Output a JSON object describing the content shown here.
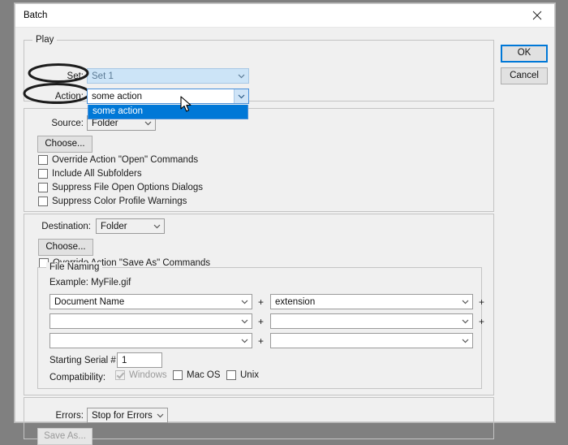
{
  "window": {
    "title": "Batch",
    "close_icon": "close-icon"
  },
  "buttons": {
    "ok": "OK",
    "cancel": "Cancel"
  },
  "play": {
    "legend": "Play",
    "set_label": "Set:",
    "set_value": "Set 1",
    "action_label": "Action:",
    "action_value": "some action",
    "action_options": [
      "some action"
    ]
  },
  "source": {
    "legend": "Source:",
    "label": "Source:",
    "value": "Folder",
    "choose_button": "Choose...",
    "checkboxes": [
      {
        "label": "Override Action \"Open\" Commands",
        "checked": false
      },
      {
        "label": "Include All Subfolders",
        "checked": false
      },
      {
        "label": "Suppress File Open Options Dialogs",
        "checked": false
      },
      {
        "label": "Suppress Color Profile Warnings",
        "checked": false
      }
    ]
  },
  "destination": {
    "label": "Destination:",
    "value": "Folder",
    "choose_button": "Choose...",
    "override_checkbox": {
      "label": "Override Action \"Save As\" Commands",
      "checked": false
    },
    "file_naming": {
      "legend": "File Naming",
      "example_label": "Example: MyFile.gif",
      "rows": [
        {
          "left": "Document Name",
          "right": "extension",
          "plus_left": "+",
          "plus_right": "+"
        },
        {
          "left": "",
          "right": "",
          "plus_left": "+",
          "plus_right": "+"
        },
        {
          "left": "",
          "right": "",
          "plus_left": "+",
          "plus_right": ""
        }
      ],
      "serial_label": "Starting Serial #:",
      "serial_value": "1",
      "compatibility_label": "Compatibility:",
      "compatibility": [
        {
          "label": "Windows",
          "checked": true,
          "disabled": true
        },
        {
          "label": "Mac OS",
          "checked": false,
          "disabled": false
        },
        {
          "label": "Unix",
          "checked": false,
          "disabled": false
        }
      ]
    }
  },
  "errors": {
    "label": "Errors:",
    "value": "Stop for Errors",
    "save_as_button": "Save As..."
  },
  "colors": {
    "accent_blue": "#0078d7",
    "selection_light_blue": "#cce4f7",
    "dialog_bg": "#f0f0f0",
    "desktop_gray": "#808080"
  }
}
